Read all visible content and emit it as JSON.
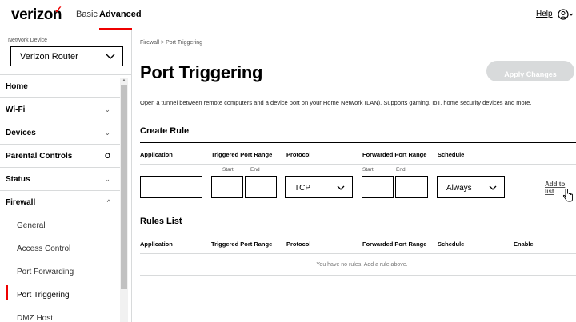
{
  "header": {
    "logo": "verizon",
    "tabs": [
      "Basic",
      "Advanced"
    ],
    "help": "Help",
    "user_icon": "user-circle-icon"
  },
  "sidebar": {
    "network_device_label": "Network Device",
    "device_value": "Verizon Router",
    "menu": [
      {
        "label": "Home",
        "indicator": ""
      },
      {
        "label": "Wi-Fi",
        "indicator": "⌄"
      },
      {
        "label": "Devices",
        "indicator": "⌄"
      },
      {
        "label": "Parental Controls",
        "indicator": "O"
      },
      {
        "label": "Status",
        "indicator": "⌄"
      },
      {
        "label": "Firewall",
        "indicator": "^"
      }
    ],
    "submenu": [
      "General",
      "Access Control",
      "Port Forwarding",
      "Port Triggering",
      "DMZ Host"
    ],
    "active_submenu": "Port Triggering"
  },
  "main": {
    "breadcrumb": "Firewall  >  Port Triggering",
    "title": "Port Triggering",
    "apply_button": "Apply Changes",
    "description": "Open a tunnel between remote computers and a device port on your Home Network (LAN). Supports gaming, IoT, home security devices and more.",
    "create_rule": {
      "title": "Create Rule",
      "columns": [
        "Application",
        "Triggered Port Range",
        "Protocol",
        "Forwarded Port Range",
        "Schedule"
      ],
      "start_label": "Start",
      "end_label": "End",
      "protocol_value": "TCP",
      "schedule_value": "Always",
      "add_link": "Add to list"
    },
    "rules_list": {
      "title": "Rules List",
      "columns": [
        "Application",
        "Triggered Port Range",
        "Protocol",
        "Forwarded Port Range",
        "Schedule",
        "Enable"
      ],
      "empty_message": "You have no rules. Add a rule above."
    }
  },
  "colors": {
    "brand_red": "#ee0000",
    "border_gray": "#d8dadb",
    "disabled_button": "#d8dadb"
  }
}
